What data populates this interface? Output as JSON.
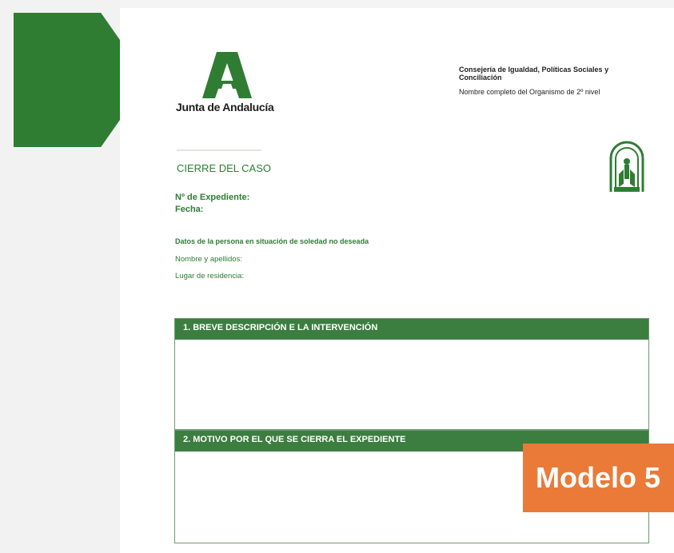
{
  "logo": {
    "text": "Junta de Andalucía",
    "color": "#2e7d32"
  },
  "header": {
    "department": "Consejería de Igualdad, Políticas Sociales y Conciliación",
    "organism": "Nombre completo del Organismo de 2º nivel"
  },
  "document": {
    "title": "CIERRE DEL CASO",
    "expediente_label": "Nº de Expediente:",
    "fecha_label": "Fecha:",
    "persona_section_title": "Datos de la persona en situación de soledad no deseada",
    "nombre_label": "Nombre y apellidos:",
    "residencia_label": "Lugar de residencia:",
    "sections": [
      {
        "heading": "1.   BREVE DESCRIPCIÓN E LA INTERVENCIÓN"
      },
      {
        "heading": "2.   MOTIVO POR EL QUE SE CIERRA EL EXPEDIENTE"
      }
    ]
  },
  "badge": {
    "label": "Modelo 5",
    "color": "#ea7a38"
  },
  "accent_color": "#2e7d32"
}
